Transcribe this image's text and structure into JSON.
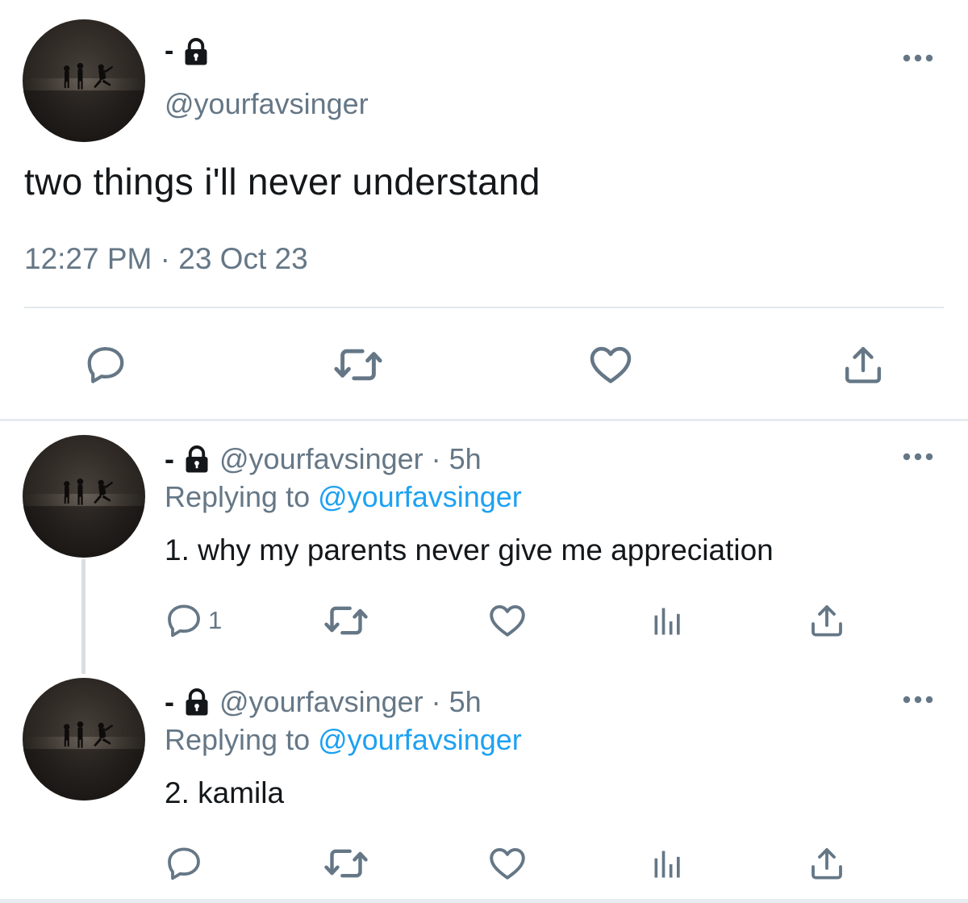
{
  "colors": {
    "text": "#14171a",
    "secondary": "#657786",
    "link": "#1da1f2",
    "divider": "#e1e8ed"
  },
  "main_tweet": {
    "name": "-",
    "handle": "@yourfavsinger",
    "text": "two things i'll never understand",
    "timestamp": "12:27 PM · 23 Oct 23",
    "actions": [
      "reply-icon",
      "retweet-icon",
      "like-icon",
      "share-icon"
    ]
  },
  "replies": [
    {
      "name": "-",
      "handle_time": "@yourfavsinger · 5h",
      "replying_prefix": "Replying to ",
      "replying_handle": "@yourfavsinger",
      "text": "1. why my parents never give me appreciation",
      "reply_count": "1"
    },
    {
      "name": "-",
      "handle_time": "@yourfavsinger · 5h",
      "replying_prefix": "Replying to ",
      "replying_handle": "@yourfavsinger",
      "text": "2. kamila",
      "reply_count": ""
    }
  ]
}
